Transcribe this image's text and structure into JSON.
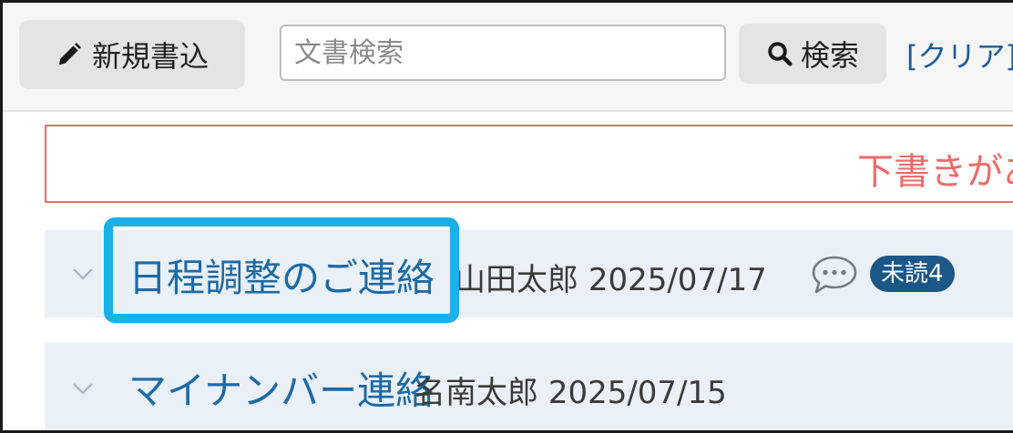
{
  "toolbar": {
    "new_button_label": "新規書込",
    "search": {
      "placeholder": "文書検索",
      "value": ""
    },
    "search_button_label": "検索",
    "clear_link_label": "[クリア]"
  },
  "draft_notice": {
    "text": "下書きがあ"
  },
  "documents": [
    {
      "title": "日程調整のご連絡",
      "author": "山田太郎",
      "date": "2025/07/17",
      "has_comments": true,
      "unread_label": "未読4"
    },
    {
      "title": "マイナンバー連絡",
      "author": "名南太郎",
      "date": "2025/07/15"
    }
  ],
  "colors": {
    "link": "#1d6aa6",
    "badge": "#1b5787",
    "draft_border": "#ef6a6a",
    "highlight": "#1ab0e8",
    "row_background": "#e9f0f7"
  },
  "icons": {
    "new": "pencil-icon",
    "search": "magnifier-icon",
    "expand": "chevron-down-icon",
    "comment": "speech-bubble-icon"
  }
}
